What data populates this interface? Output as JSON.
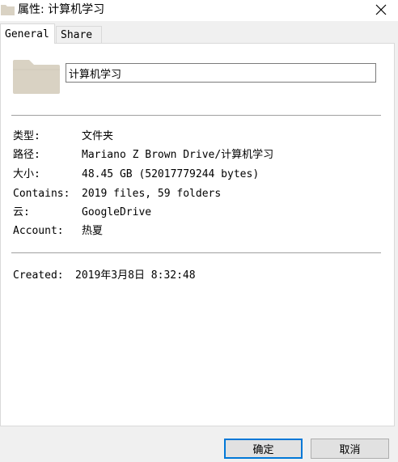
{
  "window": {
    "title": "属性: 计算机学习",
    "folder_color": "#d9d2c3"
  },
  "tabs": [
    {
      "label": "General",
      "active": true
    },
    {
      "label": "Share",
      "active": false
    }
  ],
  "general": {
    "folder_name": "计算机学习",
    "properties": [
      {
        "label": "类型:",
        "value": "文件夹"
      },
      {
        "label": "路径:",
        "value": "Mariano Z Brown Drive/计算机学习"
      },
      {
        "label": "大小:",
        "value": "48.45 GB (52017779244 bytes)"
      },
      {
        "label": "Contains:",
        "value": "2019 files, 59 folders"
      },
      {
        "label": "云:",
        "value": "GoogleDrive"
      },
      {
        "label": "Account:",
        "value": "热夏"
      }
    ],
    "created": {
      "label": "Created:",
      "value": "2019年3月8日 8:32:48"
    }
  },
  "buttons": {
    "ok_label": "确定",
    "cancel_label": "取消"
  }
}
